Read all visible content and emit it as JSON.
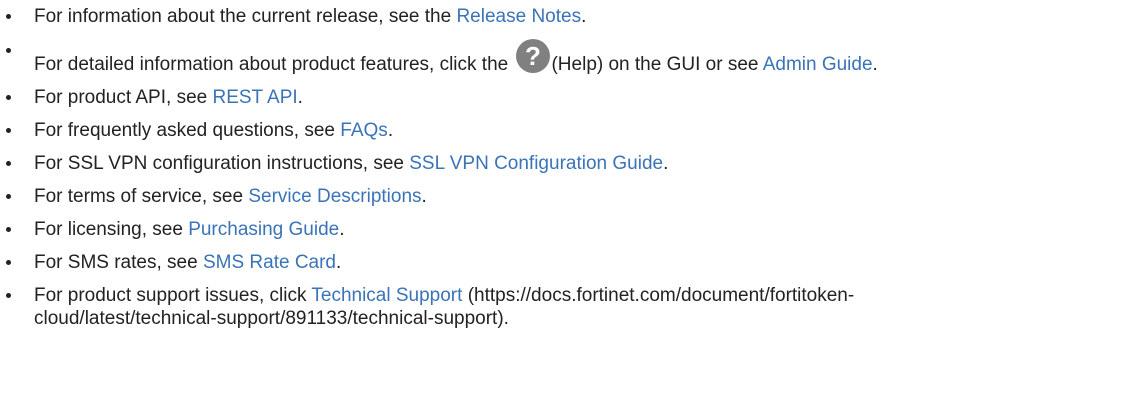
{
  "items": [
    {
      "pre": "For information about the current release, see the ",
      "link": "Release Notes",
      "post": "."
    },
    {
      "pre": "For detailed information about product features, click the ",
      "icon": "help-icon",
      "post_icon": "(Help) on the GUI or see ",
      "link": "Admin Guide",
      "post": "."
    },
    {
      "pre": "For product API, see ",
      "link": "REST API",
      "post": "."
    },
    {
      "pre": "For frequently asked questions, see ",
      "link": "FAQs",
      "post": "."
    },
    {
      "pre": "For SSL VPN configuration instructions, see ",
      "link": "SSL VPN Configuration Guide",
      "post": "."
    },
    {
      "pre": "For terms of service, see ",
      "link": "Service Descriptions",
      "post": "."
    },
    {
      "pre": "For licensing, see ",
      "link": "Purchasing Guide",
      "post": "."
    },
    {
      "pre": "For SMS rates, see ",
      "link": "SMS Rate Card",
      "post": "."
    },
    {
      "pre": "For product support issues, click ",
      "link": "Technical Support",
      "post_line1": " (https://docs.fortinet.com/document/fortitoken-",
      "post_line2": "cloud/latest/technical-support/891133/technical-support)."
    }
  ],
  "colors": {
    "link": "#3a73b8",
    "text": "#222222",
    "icon": "#808080"
  }
}
